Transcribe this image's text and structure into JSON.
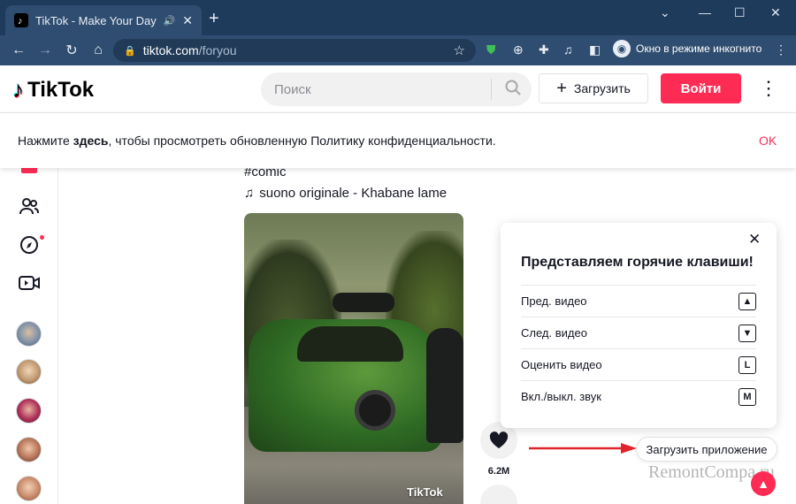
{
  "browser": {
    "tab_title": "TikTok - Make Your Day",
    "new_tab": "+",
    "url_host": "tiktok.com",
    "url_path": "/foryou",
    "incognito_label": "Окно в режиме инкогнито"
  },
  "header": {
    "logo_text": "TikTok",
    "search_placeholder": "Поиск",
    "upload_label": "Загрузить",
    "login_label": "Войти"
  },
  "banner": {
    "text_before": "Нажмите ",
    "text_bold": "здесь",
    "text_after": ", чтобы просмотреть обновленную Политику конфиденциальности.",
    "ok_label": "OK"
  },
  "post": {
    "hashtag": "#comic",
    "music": "suono originale - Khabane lame",
    "watermark": "TikTok",
    "like_count": "6.2M"
  },
  "shortcuts": {
    "title": "Представляем горячие клавиши!",
    "items": [
      {
        "label": "Пред. видео",
        "key": "▲"
      },
      {
        "label": "След. видео",
        "key": "▼"
      },
      {
        "label": "Оценить видео",
        "key": "L"
      },
      {
        "label": "Вкл./выкл. звук",
        "key": "M"
      }
    ]
  },
  "get_app_label": "Загрузить приложение",
  "site_watermark": "RemontCompa.ru",
  "colors": {
    "brand_red": "#fe2c55",
    "browser_frame": "#1f3b5c",
    "toolbar": "#2f4d70"
  }
}
